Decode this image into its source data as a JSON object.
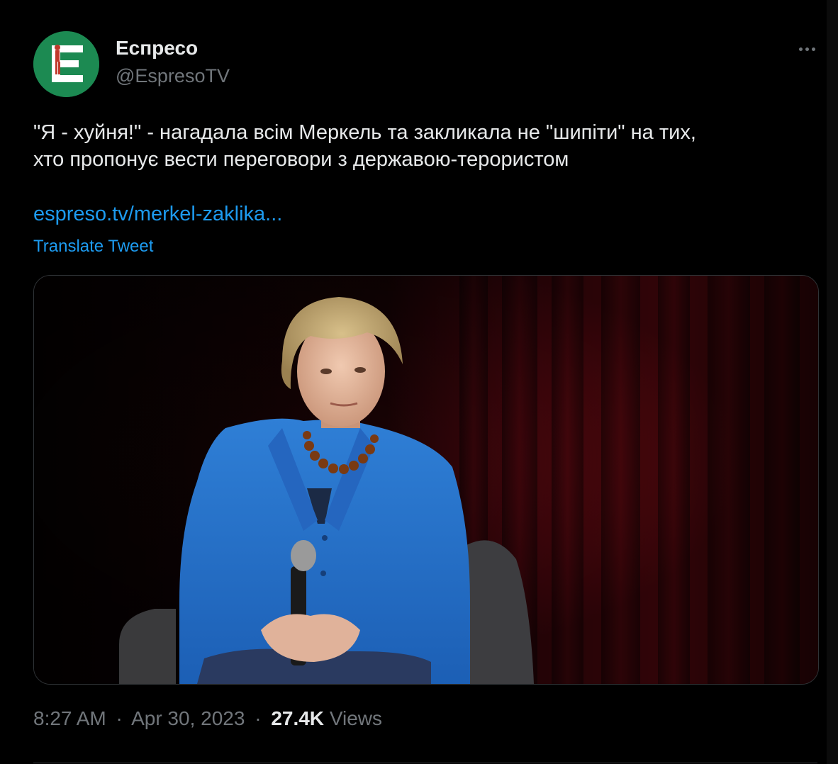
{
  "account": {
    "display_name": "Еспресо",
    "handle": "@EspresoTV",
    "avatar_icon": "espreso-logo-icon",
    "avatar_letter": "E"
  },
  "more_icon": "more-dots-icon",
  "tweet": {
    "text": "\"Я - хуйня!\" - нагадала всім Меркель та закликала не \"шипіти\" на тих,\nхто пропонує вести переговори з державою-терористом",
    "link": "espreso.tv/merkel-zaklika...",
    "translate_label": "Translate Tweet",
    "media_description_icon": "photo-icon"
  },
  "meta": {
    "time": "8:27 AM",
    "separator": "·",
    "date": "Apr 30, 2023",
    "views_count": "27.4K",
    "views_label": "Views"
  },
  "colors": {
    "background": "#000000",
    "text": "#e7e9ea",
    "secondary": "#71767b",
    "link": "#1d9bf0",
    "avatar_green": "#1c8a52"
  }
}
